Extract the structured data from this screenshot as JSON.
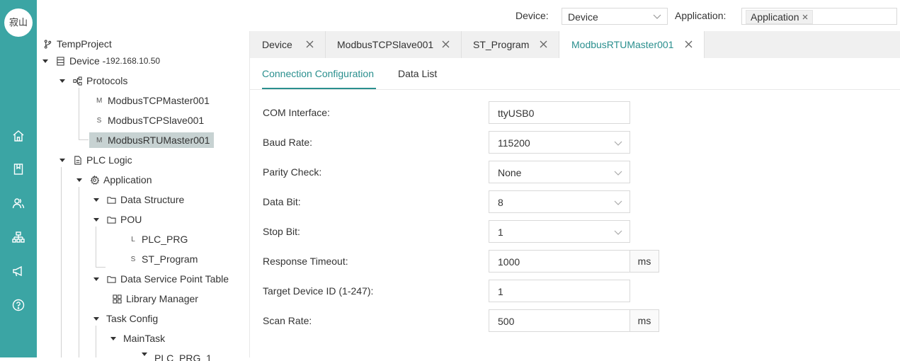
{
  "logo": {
    "text": "寂山"
  },
  "header": {
    "device_label": "Device:",
    "device_value": "Device",
    "application_label": "Application:",
    "application_tag": "Application"
  },
  "nav": {
    "icons": [
      "home-icon",
      "book-icon",
      "users-icon",
      "network-icon",
      "megaphone-icon",
      "help-icon"
    ]
  },
  "tree": {
    "project": "TempProject",
    "device": "Device - ",
    "device_ip": "192.168.10.50",
    "protocols": "Protocols",
    "protocol_items": [
      {
        "prefix": "M",
        "label": "ModbusTCPMaster001"
      },
      {
        "prefix": "S",
        "label": "ModbusTCPSlave001"
      },
      {
        "prefix": "M",
        "label": "ModbusRTUMaster001"
      }
    ],
    "plc_logic": "PLC Logic",
    "application": "Application",
    "data_structure": "Data Structure",
    "pou": "POU",
    "pou_items": [
      {
        "prefix": "L",
        "label": "PLC_PRG"
      },
      {
        "prefix": "S",
        "label": "ST_Program"
      }
    ],
    "data_service": "Data Service Point Table",
    "library_manager": "Library Manager",
    "task_config": "Task Config",
    "main_task": "MainTask",
    "partial_item": "PLC_PRG_1"
  },
  "tabs": [
    {
      "label": "Device"
    },
    {
      "label": "ModbusTCPSlave001"
    },
    {
      "label": "ST_Program"
    },
    {
      "label": "ModbusRTUMaster001"
    }
  ],
  "subtabs": {
    "connection": "Connection Configuration",
    "data_list": "Data List"
  },
  "form": {
    "com_interface": {
      "label": "COM Interface:",
      "value": "ttyUSB0"
    },
    "baud_rate": {
      "label": "Baud Rate:",
      "value": "115200"
    },
    "parity": {
      "label": "Parity Check:",
      "value": "None"
    },
    "data_bit": {
      "label": "Data Bit:",
      "value": "8"
    },
    "stop_bit": {
      "label": "Stop Bit:",
      "value": "1"
    },
    "response_timeout": {
      "label": "Response Timeout:",
      "value": "1000",
      "unit": "ms"
    },
    "target_id": {
      "label": "Target Device ID (1-247):",
      "value": "1"
    },
    "scan_rate": {
      "label": "Scan Rate:",
      "value": "500",
      "unit": "ms"
    }
  },
  "colors": {
    "rail": "#3ba5a4",
    "accent": "#2a8f8e",
    "selected_bg": "#c7d2d2"
  }
}
